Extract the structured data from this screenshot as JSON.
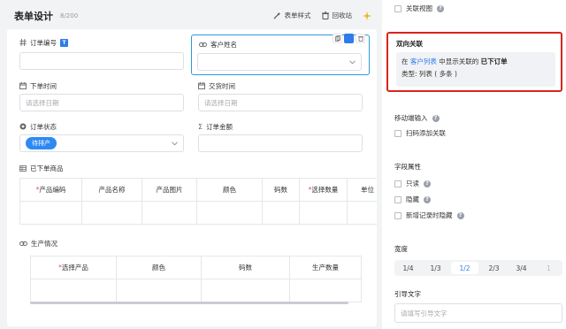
{
  "header": {
    "title": "表单设计",
    "count": "8/200",
    "style_btn": "表单样式",
    "recycle_btn": "回收站"
  },
  "form": {
    "order_no": {
      "label": "订单编号",
      "type_badge": "T"
    },
    "customer_name": {
      "label": "客户姓名"
    },
    "order_time": {
      "label": "下单时间",
      "placeholder": "请选择日期"
    },
    "delivery_time": {
      "label": "交货时间",
      "placeholder": "请选择日期"
    },
    "order_status": {
      "label": "订单状态",
      "value": "待排产"
    },
    "order_amount": {
      "label": "订单金额",
      "sigma": "Σ"
    },
    "ordered_products": {
      "label": "已下单商品",
      "columns": [
        {
          "label": "产品编码",
          "required": true
        },
        {
          "label": "产品名称",
          "required": false
        },
        {
          "label": "产品图片",
          "required": false
        },
        {
          "label": "颜色",
          "required": false
        },
        {
          "label": "码数",
          "required": false
        },
        {
          "label": "选择数量",
          "required": true
        },
        {
          "label": "单位",
          "required": false
        }
      ]
    },
    "production": {
      "label": "生产情况",
      "columns": [
        {
          "label": "选择产品",
          "required": true
        },
        {
          "label": "颜色",
          "required": false
        },
        {
          "label": "码数",
          "required": false
        },
        {
          "label": "生产数量",
          "required": false
        }
      ]
    }
  },
  "props": {
    "linked_view": "关联视图",
    "bidirectional": {
      "title": "双向关联",
      "line1_pre": "在",
      "line1_link": "客户列表",
      "line1_mid": "中显示关联的",
      "line1_bold": "已下订单",
      "line2": "类型: 列表 ( 多条 )"
    },
    "mobile_input": {
      "title": "移动端输入",
      "scan_add": "扫码添加关联"
    },
    "field_attrs": {
      "title": "字段属性",
      "readonly": "只读",
      "hidden": "隐藏",
      "hide_on_new": "新增记录时隐藏"
    },
    "width": {
      "title": "宽度",
      "options": [
        "1/4",
        "1/3",
        "1/2",
        "2/3",
        "3/4",
        "1"
      ],
      "selected": "1/2"
    },
    "guide": {
      "title": "引导文字",
      "placeholder": "请填写引导文字"
    },
    "help_mark": "?"
  },
  "colors": {
    "accent": "#2e7ce8",
    "highlight_border": "#d9241c",
    "selected_field_border": "#2e9bd8",
    "status_pill": "#2e8af2"
  }
}
